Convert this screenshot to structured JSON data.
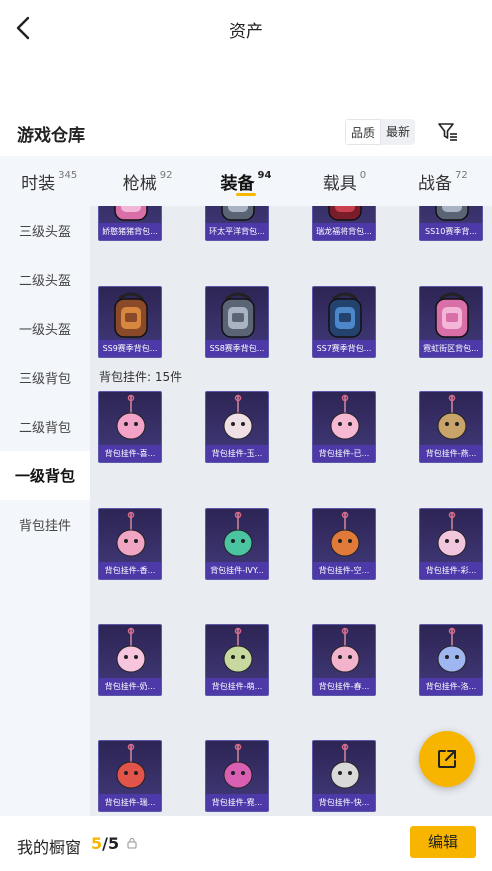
{
  "header": {
    "title": "资产",
    "back_icon": "chevron-left-icon"
  },
  "section": {
    "title": "游戏仓库",
    "sort_options": [
      "品质",
      "最新"
    ],
    "sort_selected": "品质",
    "filter_icon": "filter-icon"
  },
  "tabs": [
    {
      "label": "时装",
      "count": "345"
    },
    {
      "label": "枪械",
      "count": "92"
    },
    {
      "label": "装备",
      "count": "94",
      "active": true
    },
    {
      "label": "载具",
      "count": "0"
    },
    {
      "label": "战备",
      "count": "72"
    }
  ],
  "sidebar": [
    {
      "label": "三级头盔"
    },
    {
      "label": "二级头盔"
    },
    {
      "label": "一级头盔"
    },
    {
      "label": "三级背包"
    },
    {
      "label": "二级背包"
    },
    {
      "label": "一级背包",
      "active": true
    },
    {
      "label": "背包挂件"
    }
  ],
  "backpacks_partial": [
    {
      "label": "娇憨猪猪背包...",
      "kind": "pack-pink"
    },
    {
      "label": "环太平洋背包...",
      "kind": "pack-grey"
    },
    {
      "label": "瑞龙福将背包...",
      "kind": "pack-red"
    },
    {
      "label": "SS10赛季背...",
      "kind": "pack-grey"
    }
  ],
  "backpacks": [
    {
      "label": "SS9赛季背包...",
      "kind": "pack-orange"
    },
    {
      "label": "SS8赛季背包...",
      "kind": "pack-grey"
    },
    {
      "label": "SS7赛季背包...",
      "kind": "pack-blue"
    },
    {
      "label": "霓虹街区背包...",
      "kind": "pack-pink"
    }
  ],
  "pendant_group_label": "背包挂件: 15件",
  "pendants": [
    {
      "label": "背包挂件-喜...",
      "kind": "bow"
    },
    {
      "label": "背包挂件-玉...",
      "kind": "bunny"
    },
    {
      "label": "背包挂件-已...",
      "kind": "cat"
    },
    {
      "label": "背包挂件-燕...",
      "kind": "swallow"
    },
    {
      "label": "背包挂件-香...",
      "kind": "flower"
    },
    {
      "label": "背包挂件-IVY...",
      "kind": "leaf"
    },
    {
      "label": "背包挂件-空...",
      "kind": "horn"
    },
    {
      "label": "背包挂件-彩...",
      "kind": "stick"
    },
    {
      "label": "背包挂件-奶...",
      "kind": "dumpling"
    },
    {
      "label": "背包挂件-萌...",
      "kind": "zongzi"
    },
    {
      "label": "背包挂件-春...",
      "kind": "dress"
    },
    {
      "label": "背包挂件-洛...",
      "kind": "knot"
    },
    {
      "label": "背包挂件-瑞...",
      "kind": "lantern"
    },
    {
      "label": "背包挂件-霓...",
      "kind": "shoe"
    },
    {
      "label": "背包挂件-快...",
      "kind": "face"
    }
  ],
  "float_button_icon": "external-share-icon",
  "footer": {
    "label": "我的橱窗",
    "current": "5",
    "total": "/5",
    "lock_icon": "lock-icon",
    "edit_label": "编辑"
  },
  "colors": {
    "accent": "#f7b500",
    "card_bg": "#2d2554",
    "card_label": "#4d3aa8"
  }
}
